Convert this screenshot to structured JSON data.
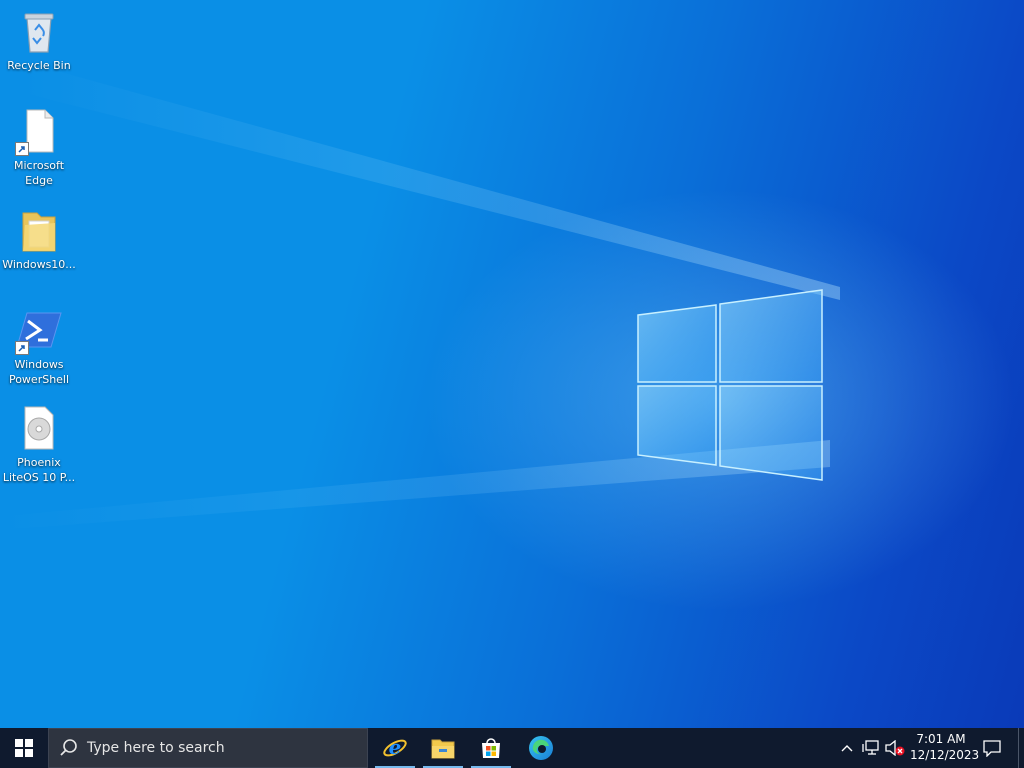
{
  "desktop": {
    "icons": [
      {
        "label": "Recycle Bin",
        "icon": "recycle-bin-icon"
      },
      {
        "label": "Microsoft\nEdge",
        "icon": "file-icon",
        "shortcut": true
      },
      {
        "label": "Windows10...",
        "icon": "folder-icon"
      },
      {
        "label": "Windows\nPowerShell",
        "icon": "powershell-icon",
        "shortcut": true
      },
      {
        "label": "Phoenix\nLiteOS 10 P...",
        "icon": "disc-image-icon"
      }
    ],
    "wallpaper_colors": {
      "light": "#0a8fe6",
      "dark": "#0a3ab8",
      "glow": "#8fd4ff"
    }
  },
  "taskbar": {
    "start_icon": "windows-icon",
    "search": {
      "placeholder": "Type here to search",
      "icon": "search-icon"
    },
    "apps": [
      {
        "name": "Internet Explorer",
        "icon": "internet-explorer-icon",
        "running": true
      },
      {
        "name": "File Explorer",
        "icon": "file-explorer-icon",
        "running": true
      },
      {
        "name": "Microsoft Store",
        "icon": "microsoft-store-icon",
        "running": true
      },
      {
        "name": "Microsoft Edge",
        "icon": "edge-icon",
        "running": false
      }
    ],
    "tray": {
      "chevron_icon": "chevron-up-icon",
      "network_icon": "network-icon",
      "volume_icon": "volume-muted-icon",
      "time": "7:01 AM",
      "date": "12/12/2023",
      "notification_icon": "action-center-icon"
    },
    "background": "#0f1a2e"
  }
}
